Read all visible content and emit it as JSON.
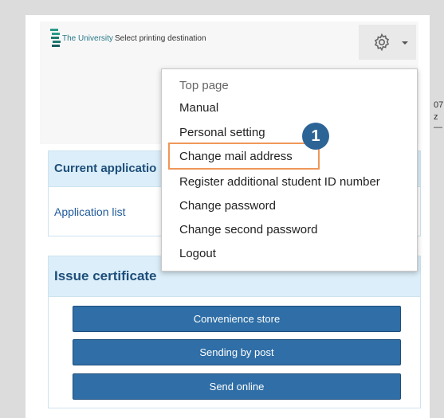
{
  "header": {
    "brand": "The University",
    "subtitle": "Select printing destination",
    "settings_icon": "gear-icon",
    "edge_fragments": [
      "07",
      "z",
      "—"
    ]
  },
  "current_panel": {
    "title": "Current applicatio",
    "link": "Application list"
  },
  "issue_panel": {
    "title": "Issue certificate",
    "buttons": [
      "Convenience store",
      "Sending by post",
      "Send online"
    ]
  },
  "settings_menu": {
    "items": [
      "Top page",
      "Manual",
      "Personal setting",
      "Change mail address",
      "Register additional student ID number",
      "Change password",
      "Change second password",
      "Logout"
    ],
    "highlighted_item": "Change mail address"
  },
  "step_badge": "1",
  "colors": {
    "panel_header_bg": "#dbeef9",
    "button_bg": "#2f6ea6",
    "highlight_border": "#f0975a",
    "badge_bg": "#2d6496"
  }
}
